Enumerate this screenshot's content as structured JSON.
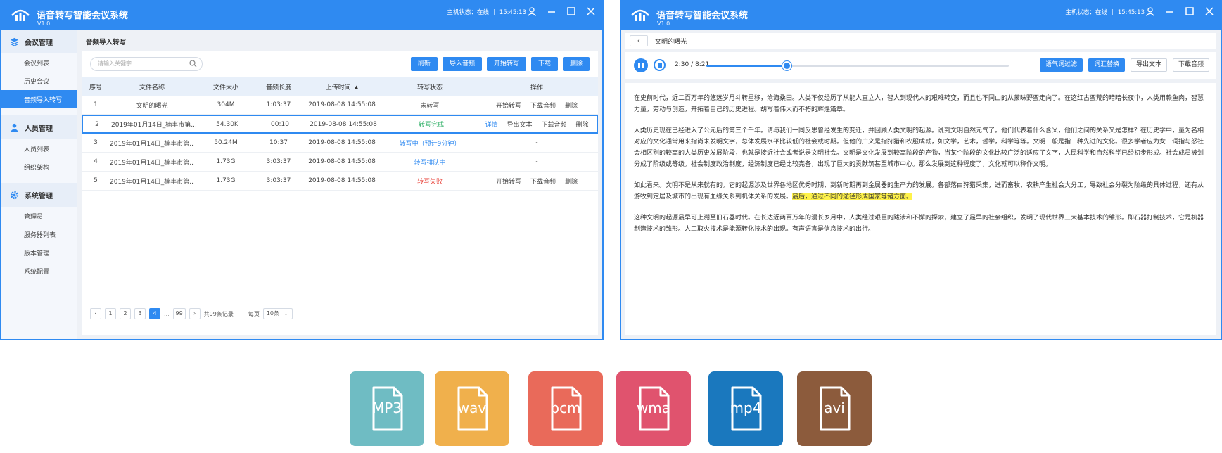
{
  "app": {
    "title": "语音转写智能会议系统",
    "version": "V1.0",
    "status_label": "主机状态：在线",
    "clock": "15:45:13"
  },
  "sidebar": {
    "groups": [
      {
        "label": "会议管理",
        "items": [
          "会议列表",
          "历史会议",
          "音频导入转写"
        ]
      },
      {
        "label": "人员管理",
        "items": [
          "人员列表",
          "组织架构"
        ]
      },
      {
        "label": "系统管理",
        "items": [
          "管理员",
          "服务器列表",
          "版本管理",
          "系统配置"
        ]
      }
    ],
    "active_item": "音频导入转写"
  },
  "left": {
    "breadcrumb": "音频导入转写",
    "search_placeholder": "请输入关键字",
    "buttons": {
      "refresh": "刷新",
      "import": "导入音频",
      "start": "开始转写",
      "download": "下载",
      "delete": "删除"
    },
    "columns": [
      "序号",
      "文件名称",
      "文件大小",
      "音频长度",
      "上传时间",
      "转写状态",
      "操作"
    ],
    "rows": [
      {
        "no": "1",
        "name": "文明的曙光",
        "size": "304M",
        "len": "1:03:37",
        "time": "2019-08-08 14:55:08",
        "status": "未转写",
        "ops": [
          "开始转写",
          "下载音频",
          "删除"
        ]
      },
      {
        "no": "2",
        "name": "2019年01月14日_楠丰市第...",
        "size": "54.30K",
        "len": "00:10",
        "time": "2019-08-08 14:55:08",
        "status": "转写完成",
        "ops": [
          "详情",
          "导出文本",
          "下载音频",
          "删除"
        ]
      },
      {
        "no": "3",
        "name": "2019年01月14日_楠丰市第...",
        "size": "50.24M",
        "len": "10:37",
        "time": "2019-08-08 14:55:08",
        "status": "转写中（预计9分钟）",
        "ops": [
          "-"
        ]
      },
      {
        "no": "4",
        "name": "2019年01月14日_楠丰市第...",
        "size": "1.73G",
        "len": "3:03:37",
        "time": "2019-08-08 14:55:08",
        "status": "转写排队中",
        "ops": [
          "-"
        ]
      },
      {
        "no": "5",
        "name": "2019年01月14日_楠丰市第...",
        "size": "1.73G",
        "len": "3:03:37",
        "time": "2019-08-08 14:55:08",
        "status": "转写失败",
        "ops": [
          "开始转写",
          "下载音频",
          "删除"
        ]
      }
    ],
    "pager": {
      "pages": [
        "1",
        "2",
        "3",
        "4"
      ],
      "ellipsis": "...",
      "last": "99",
      "total": "共99条记录",
      "per_page_label": "每页",
      "per_page_value": "10条",
      "prev": "‹",
      "next": "›"
    }
  },
  "right": {
    "title": "文明的曙光",
    "player": {
      "time": "2:30 / 8:21",
      "progress": 0.265
    },
    "buttons": {
      "filter": "语气词过滤",
      "replace": "词汇替换",
      "export": "导出文本",
      "download": "下载音频"
    },
    "paragraphs": [
      "在史前时代，近二百万年的悠远岁月斗转星移，沧海桑田。人类不仅经历了从能人直立人，智人到现代人的艰难转变，而且也不同山的从蒙昧野蛮走向了。在这红古蛮荒的暗暗长夜中，人类用赖鱼肉，智慧力量，劳动与创造，开拓着自己的历史进程。胡写着伟大而不朽的辉煌篇章。",
      "人类历史现在已经进入了公元后的第三个千年。请与我们一同反思曾经发生的变迁，并回顾人类文明的起源。说到文明自然元气了。他们代表着什么含义，他们之间的关系又是怎样？在历史学中，量为名相对应的文化通常用来指尚未发明文字，总体发展水平比较低的社会或时期。但他的广义是指狩猎和农服成就，如文学，艺术，哲学，科学等等。文明一般是指一种先进的文化。很多学者应为女一词指与怒社会相区别的较高的人类历史发展阶段，也就是接近社会或者说是文明社会。文明是文化发展到较高阶段的产物，当某个阶段的文化比较广泛的适应了文字，人民科学和自然科学已经初步形成。社会成员被划分成了阶级或等级。社会制度政治制度，经济制度已经比较完备，出现了巨大的贡献筑甚至城市中心。那么发展到这种程度了，文化就可以称作文明。",
      "这种文明的起源最早可上溯至旧石器时代。在长达近两百万年的漫长岁月中，人类经过艰巨的跋涉和不懈的探索，建立了最早的社会组织，发明了现代世界三大基本技术的雏形。即石器打制技术，它是机器制造技术的雏形。人工取火技术是能源转化技术的出现。有声语言是信息技术的出行。"
    ],
    "para3_plain": "如此看来。文明不是从来就有的。它的起源涉及世界各地区优秀时期，到新时期再到金属器的生产力的发展。各部落由狩猎采集，进而畜牧，农耕产生社会大分工，导致社会分裂为阶级的具体过程，还有从游牧到定居及城市的出现有血缘关系到机体关系的发展。",
    "para3_highlight": "最后，通过不同的途径形成国家等诸方面。"
  },
  "formats": [
    {
      "label": "MP3",
      "color": "#6fbcc3"
    },
    {
      "label": "wav",
      "color": "#f0b04c"
    },
    {
      "label": "pcm",
      "color": "#e96a5a"
    },
    {
      "label": "wma",
      "color": "#e0536e"
    },
    {
      "label": "mp4",
      "color": "#1a78be"
    },
    {
      "label": "avi",
      "color": "#8c5b3c"
    }
  ]
}
